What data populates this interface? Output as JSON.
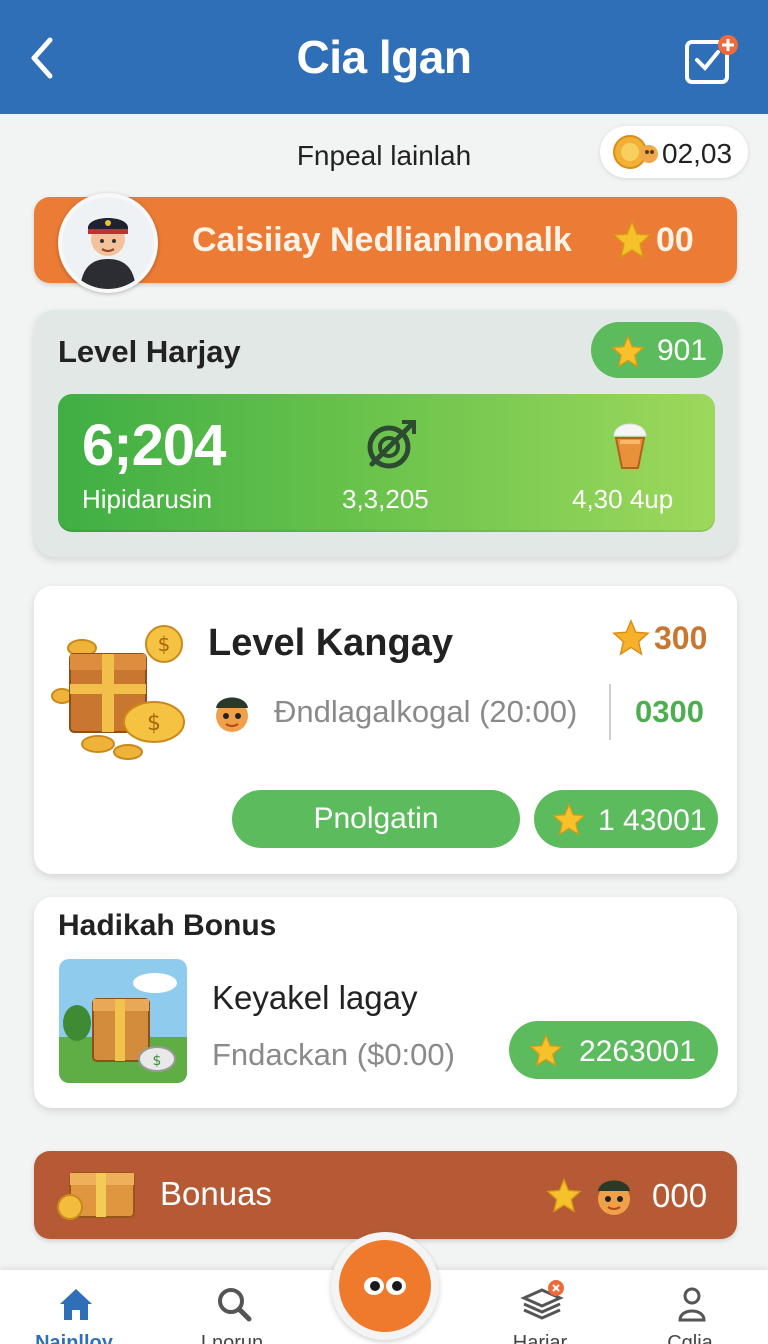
{
  "header": {
    "title": "Cia lgan",
    "back_icon": "chevron-left-icon",
    "task_icon": "clipboard-check-icon"
  },
  "subheader": {
    "text": "Fnpeal lainlah",
    "coin_value": "02,03"
  },
  "banner": {
    "title": "Caisiiay Nedlianlnonalk",
    "stars": "00"
  },
  "level_card": {
    "title": "Level Harjay",
    "stars": "901",
    "big_value": "6;204",
    "big_label": "Hipidarusin",
    "mid_value": "3,3,205",
    "right_value": "4,30 4up"
  },
  "quest_card": {
    "title": "Level Kangay",
    "stars": "300",
    "subtitle": "Ðndlagalkogal (20:00)",
    "green_value": "0300",
    "button_label": "Pnolgatin",
    "reward_value": "1 43001"
  },
  "hadikah": {
    "section_title": "Hadikah Bonus",
    "item_name": "Keyakel lagay",
    "item_sub": "Fndackan ($0:00)",
    "reward_value": "2263001"
  },
  "bonus_bar": {
    "label": "Bonuas",
    "value": "000"
  },
  "bottom_nav": {
    "items": [
      {
        "label": "Nainlloy",
        "icon": "home-icon"
      },
      {
        "label": "Lnorun",
        "icon": "search-icon"
      },
      {
        "label": "Hariar",
        "icon": "layers-icon"
      },
      {
        "label": "Cglia",
        "icon": "person-icon"
      }
    ]
  },
  "colors": {
    "header_blue": "#2f6fb8",
    "orange": "#ec7b35",
    "green": "#5cbb5c",
    "bonus_brown": "#b55a35"
  }
}
